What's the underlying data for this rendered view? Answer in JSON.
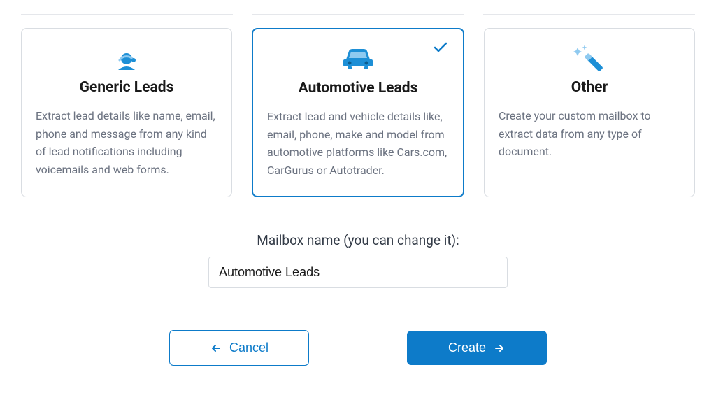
{
  "cards": [
    {
      "title": "Generic Leads",
      "description": "Extract lead details like name, email, phone and message from any kind of lead notifications including voicemails and web forms.",
      "selected": false
    },
    {
      "title": "Automotive Leads",
      "description": "Extract lead and vehicle details like, email, phone, make and model from automotive platforms like Cars.com, CarGurus or Autotrader.",
      "selected": true
    },
    {
      "title": "Other",
      "description": "Create your custom mailbox to extract data from any type of document.",
      "selected": false
    }
  ],
  "form": {
    "label": "Mailbox name (you can change it):",
    "value": "Automotive Leads"
  },
  "buttons": {
    "cancel": "Cancel",
    "create": "Create"
  },
  "colors": {
    "primary": "#0d7bc9",
    "icon_light": "#8fcaf0"
  }
}
